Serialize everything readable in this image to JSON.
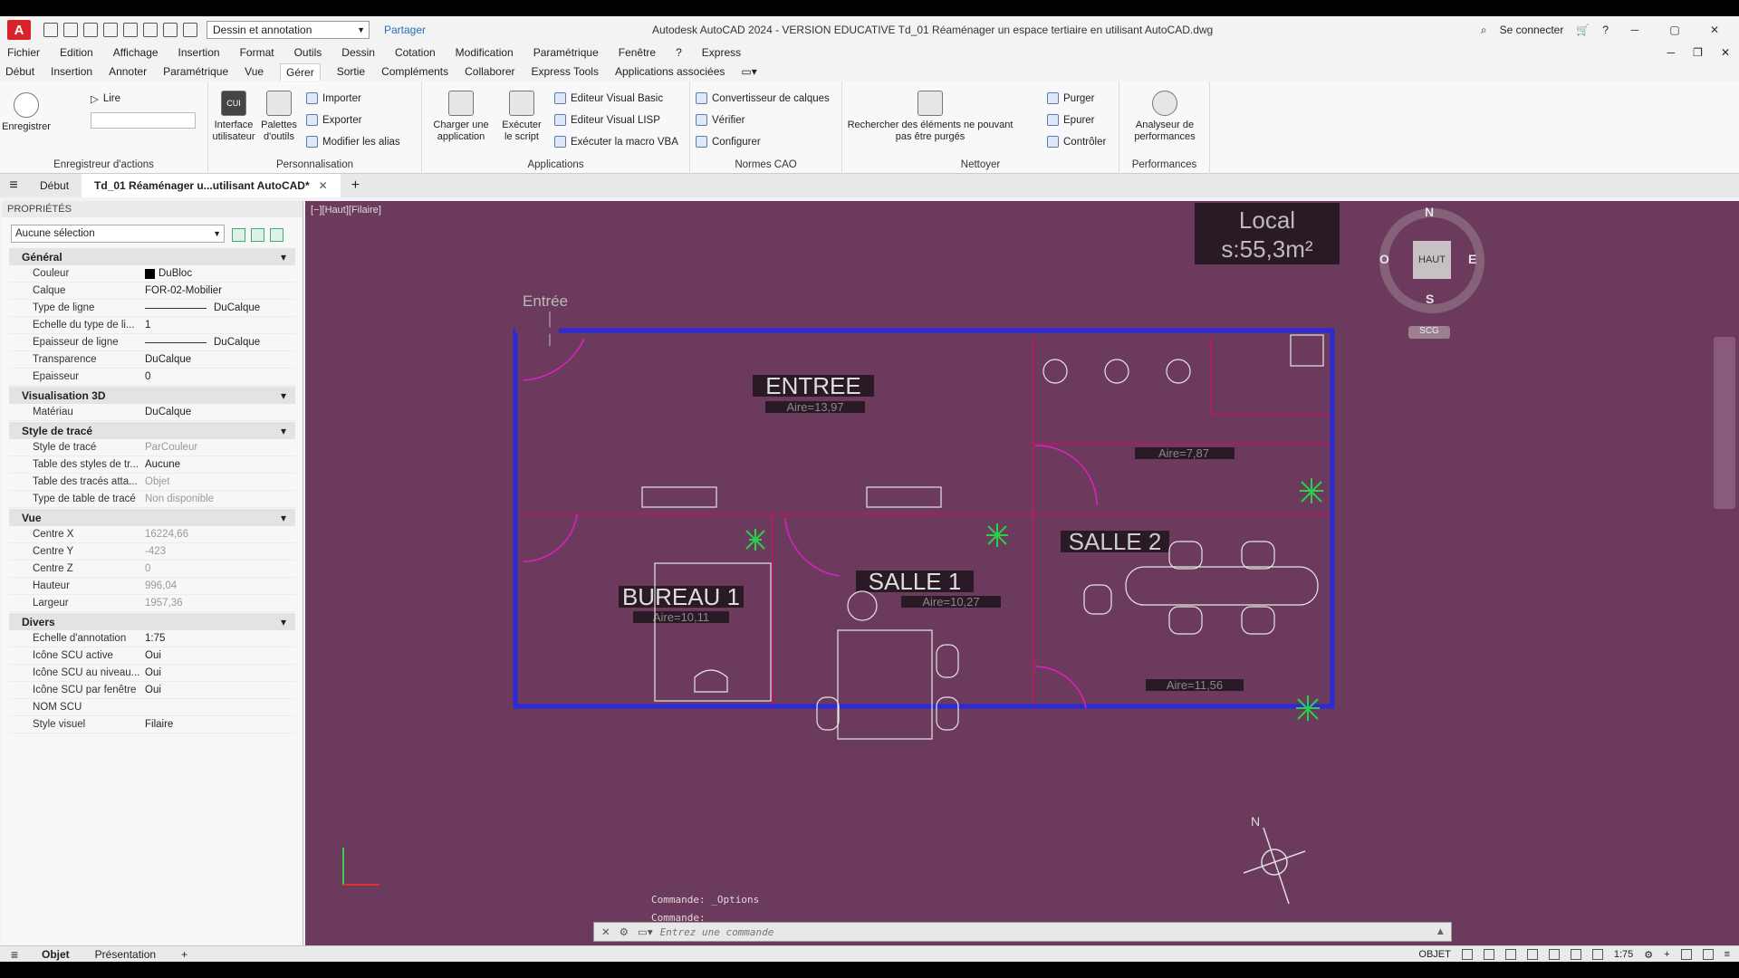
{
  "titlebar": {
    "logo": "A",
    "workspace": "Dessin et annotation",
    "share": "Partager",
    "title": "Autodesk AutoCAD 2024 - VERSION EDUCATIVE    Td_01 Réaménager un espace tertiaire en utilisant AutoCAD.dwg",
    "signin": "Se connecter"
  },
  "menubar": {
    "items": [
      "Fichier",
      "Edition",
      "Affichage",
      "Insertion",
      "Format",
      "Outils",
      "Dessin",
      "Cotation",
      "Modification",
      "Paramétrique",
      "Fenêtre",
      "?",
      "Express"
    ]
  },
  "ribbon_tabs": {
    "items": [
      "Début",
      "Insertion",
      "Annoter",
      "Paramétrique",
      "Vue",
      "Gérer",
      "Sortie",
      "Compléments",
      "Collaborer",
      "Express Tools",
      "Applications associées"
    ],
    "active": "Gérer"
  },
  "ribbon": {
    "enregistreur": {
      "title": "Enregistreur d'actions",
      "record": "Enregistrer",
      "play": "Lire"
    },
    "personnalisation": {
      "title": "Personnalisation",
      "cui": "Interface utilisateur",
      "cui_badge": "CUI",
      "palettes": "Palettes d'outils",
      "import": "Importer",
      "export": "Exporter",
      "alias": "Modifier les alias"
    },
    "applications": {
      "title": "Applications",
      "charger": "Charger une application",
      "executer": "Exécuter le script",
      "vba": "Editeur Visual Basic",
      "lisp": "Editeur Visual LISP",
      "macro": "Exécuter la macro VBA"
    },
    "normes": {
      "title": "Normes CAO",
      "convertisseur": "Convertisseur de calques",
      "verifier": "Vérifier",
      "configurer": "Configurer"
    },
    "nettoyer": {
      "title": "Nettoyer",
      "rechercher": "Rechercher des éléments ne pouvant pas être purgés",
      "purger": "Purger",
      "epurer": "Epurer",
      "controler": "Contrôler"
    },
    "performances": {
      "title": "Performances",
      "analyseur": "Analyseur de performances"
    }
  },
  "doctabs": {
    "home": "Début",
    "active": "Td_01 Réaménager u...utilisant AutoCAD*"
  },
  "properties": {
    "header": "PROPRIÉTÉS",
    "selection": "Aucune sélection",
    "sections": [
      {
        "title": "Général",
        "rows": [
          {
            "k": "Couleur",
            "v": "DuBloc"
          },
          {
            "k": "Calque",
            "v": "FOR-02-Mobilier"
          },
          {
            "k": "Type de ligne",
            "v": "DuCalque"
          },
          {
            "k": "Echelle du type de li...",
            "v": "1"
          },
          {
            "k": "Epaisseur de ligne",
            "v": "DuCalque"
          },
          {
            "k": "Transparence",
            "v": "DuCalque"
          },
          {
            "k": "Epaisseur",
            "v": "0"
          }
        ]
      },
      {
        "title": "Visualisation 3D",
        "rows": [
          {
            "k": "Matériau",
            "v": "DuCalque"
          }
        ]
      },
      {
        "title": "Style de tracé",
        "rows": [
          {
            "k": "Style de tracé",
            "v": "ParCouleur"
          },
          {
            "k": "Table des styles de tr...",
            "v": "Aucune"
          },
          {
            "k": "Table des tracés atta...",
            "v": "Objet"
          },
          {
            "k": "Type de table de tracé",
            "v": "Non disponible"
          }
        ]
      },
      {
        "title": "Vue",
        "rows": [
          {
            "k": "Centre X",
            "v": "16224,66"
          },
          {
            "k": "Centre Y",
            "v": "-423"
          },
          {
            "k": "Centre Z",
            "v": "0"
          },
          {
            "k": "Hauteur",
            "v": "996,04"
          },
          {
            "k": "Largeur",
            "v": "1957,36"
          }
        ]
      },
      {
        "title": "Divers",
        "rows": [
          {
            "k": "Echelle d'annotation",
            "v": "1:75"
          },
          {
            "k": "Icône SCU active",
            "v": "Oui"
          },
          {
            "k": "Icône SCU au niveau...",
            "v": "Oui"
          },
          {
            "k": "Icône SCU par fenêtre",
            "v": "Oui"
          },
          {
            "k": "NOM SCU",
            "v": ""
          },
          {
            "k": "Style visuel",
            "v": "Filaire"
          }
        ]
      }
    ]
  },
  "drawing": {
    "viewport_label": "[−][Haut][Filaire]",
    "local_title": "Local",
    "local_area": "s:55,3m²",
    "entree": "Entrée",
    "rooms": [
      {
        "name": "ENTREE",
        "area": "Aire=13,97"
      },
      {
        "name": "BUREAU 1",
        "area": "Aire=10,11"
      },
      {
        "name": "SALLE 1",
        "area": "Aire=10,27"
      },
      {
        "name": "SALLE 2",
        "area": "Aire=11,56"
      },
      {
        "name": "",
        "area": "Aire=7,87"
      }
    ],
    "viewcube": {
      "n": "N",
      "s": "S",
      "e": "E",
      "o": "O",
      "top": "HAUT",
      "scu": "SCG"
    },
    "north": "N"
  },
  "command": {
    "history": [
      "Commande: _Options",
      "Commande:"
    ],
    "placeholder": "Entrez une commande"
  },
  "statusbar": {
    "tabs": [
      "Objet",
      "Présentation"
    ],
    "model": "OBJET",
    "scale": "1:75"
  },
  "colors": {
    "canvas": "#6b3a5c",
    "walls": "#2a2ad8",
    "partition": "#c01860",
    "door": "#e020c0",
    "plant": "#2bd04a"
  }
}
